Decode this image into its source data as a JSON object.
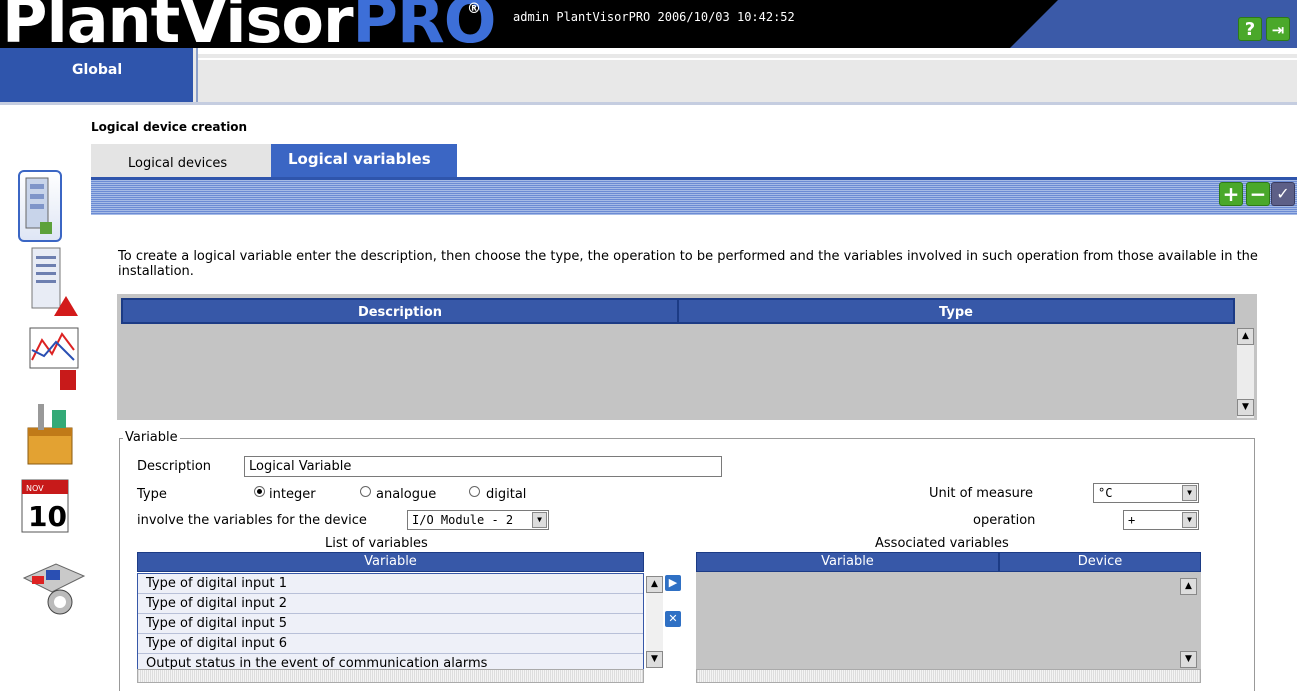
{
  "header": {
    "logo_part1": "PlantVisor",
    "logo_part2": "PRO",
    "logo_reg": "®",
    "info": "admin PlantVisorPRO 2006/10/03 10:42:52",
    "help_icon": "?",
    "logout_icon": "⇥"
  },
  "global_tab": "Global",
  "page_title": "Logical device creation",
  "tabs": {
    "devices": "Logical devices",
    "variables": "Logical variables"
  },
  "actions": {
    "add": "+",
    "remove": "−",
    "confirm": "✓"
  },
  "intro": "To create a logical variable enter the description, then choose the type, the operation to be performed and the variables involved in such operation from those available in the installation.",
  "table": {
    "col_description": "Description",
    "col_type": "Type"
  },
  "variable_section": {
    "legend": "Variable",
    "description_label": "Description",
    "description_value": "Logical Variable",
    "type_label": "Type",
    "type_options": [
      "integer",
      "analogue",
      "digital"
    ],
    "type_selected": "integer",
    "unit_label": "Unit of measure",
    "unit_value": "°C",
    "device_label": "involve the variables for the device",
    "device_value": "I/O Module - 2",
    "operation_label": "operation",
    "operation_value": "+",
    "list_title": "List of variables",
    "list_col": "Variable",
    "list_items": [
      "Type of digital input 1",
      "Type of digital input 2",
      "Type of digital input 5",
      "Type of digital input 6",
      "Output status in the event of communication alarms"
    ],
    "assoc_title": "Associated variables",
    "assoc_col_variable": "Variable",
    "assoc_col_device": "Device"
  },
  "colors": {
    "header_blue": "#3b5aa8",
    "tab_blue": "#3b66c4",
    "table_header": "#3758a8",
    "accent_green": "#4aa82a"
  }
}
